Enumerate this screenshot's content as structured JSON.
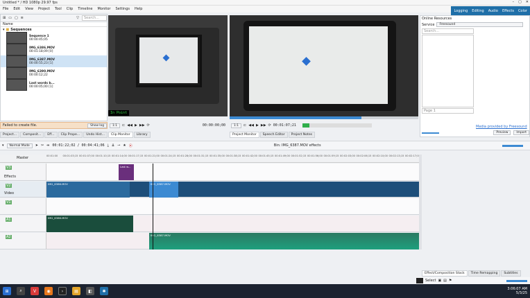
{
  "window": {
    "title": "Untitled * / HD 1080p 29.97 fps",
    "controls": [
      "–",
      "▢",
      "✕"
    ]
  },
  "menu": [
    "File",
    "Edit",
    "View",
    "Project",
    "Tool",
    "Clip",
    "Timeline",
    "Monitor",
    "Settings",
    "Help"
  ],
  "layouts": [
    "Logging",
    "Editing",
    "Audio",
    "Effects",
    "Color"
  ],
  "bin": {
    "search_placeholder": "Search...",
    "column": "Name",
    "folder": "Sequences",
    "items": [
      {
        "name": "Sequence 1",
        "duration": "00:00:45;05",
        "selected": false
      },
      {
        "name": "IMG_6386.MOV",
        "duration": "00:01:18;09 [0]",
        "selected": false
      },
      {
        "name": "IMG_6387.MOV",
        "duration": "00:00:55;23 [1]",
        "selected": true
      },
      {
        "name": "IMG_6390.MOV",
        "duration": "00:00:12;22",
        "selected": false
      },
      {
        "name": "Last words b...",
        "duration": "00:00:05;00 [1]",
        "selected": false
      }
    ]
  },
  "notification": {
    "text": "Failed to create file.",
    "button": "Show log"
  },
  "left_tabs": [
    "Project...",
    "Composit...",
    "Eff...",
    "Clip Prope...",
    "Undo Hist...",
    "Clip Monitor",
    "Library"
  ],
  "clip_monitor": {
    "label": "In Point",
    "zoom": "1:1",
    "timecode": "00:00:00;00"
  },
  "project_monitor": {
    "zoom": "1:1",
    "timecode": "00:01:07;21"
  },
  "monitor_tabs": [
    "Project Monitor",
    "Speech Editor",
    "Project Notes"
  ],
  "online_resources": {
    "title": "Online Resources",
    "service_label": "Service",
    "service": "Freesound",
    "search_placeholder": "Search...",
    "page": "Page 1",
    "provider": "Media provided by Freesound",
    "preview": "Preview",
    "import": "Import"
  },
  "timeline": {
    "mode": "Normal Mode",
    "position": "00:01:22;02 / 00:04:41;06",
    "master": "Master",
    "bin_effects": "Bin: IMG_6387.MOV effects",
    "ruler_ticks": [
      "00:01:00",
      "00:01:03;15",
      "00:01:07;00",
      "00:01:10;15",
      "00:01:14;00",
      "00:01:17;15",
      "00:01:21;00",
      "00:01:24;15",
      "00:01:28;00",
      "00:01:31;15",
      "00:01:35;00",
      "00:01:38;15",
      "00:01:42;00",
      "00:01:45;15",
      "00:01:49;00",
      "00:01:52;15",
      "00:01:56;00",
      "00:01:59;15",
      "00:02:03;00",
      "00:02:06;15",
      "00:02:10;00",
      "00:02:13;15",
      "00:02:17;00"
    ],
    "tracks": [
      {
        "id": "V3",
        "label": "Effects"
      },
      {
        "id": "V2",
        "label": "Video"
      },
      {
        "id": "V1",
        "label": ""
      },
      {
        "id": "A1",
        "label": ""
      },
      {
        "id": "A2",
        "label": ""
      }
    ],
    "clip_names": {
      "effects_clip": "Last w...",
      "video_a": "IMG_6386.MOV",
      "video_b": "IMG_6387.MOV",
      "audio_a": "IMG_6386.MOV",
      "audio_b": "IMG_6387.MOV"
    }
  },
  "bottom_tabs": [
    "Effect/Composition Stack",
    "Time Remapping",
    "Subtitles"
  ],
  "bottom_toolbar": {
    "select": "Select"
  },
  "taskbar": {
    "time": "3:06:07 AM",
    "date": "5/3/25"
  },
  "colors": {
    "accent": "#1f6fa8",
    "video_track": "#1d4e7a",
    "audio_clip": "#1e9f7d",
    "clip_blue": "#3c8ad2"
  }
}
